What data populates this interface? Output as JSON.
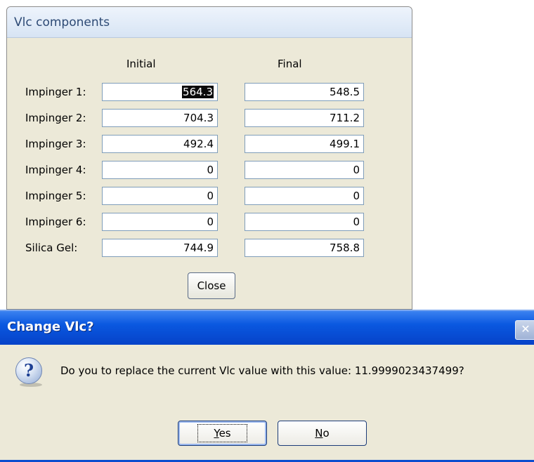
{
  "vlc_window": {
    "title": "Vlc components",
    "columns": {
      "initial": "Initial",
      "final": "Final"
    },
    "rows": [
      {
        "label": "Impinger 1:",
        "initial": "564.3",
        "final": "548.5"
      },
      {
        "label": "Impinger 2:",
        "initial": "704.3",
        "final": "711.2"
      },
      {
        "label": "Impinger 3:",
        "initial": "492.4",
        "final": "499.1"
      },
      {
        "label": "Impinger 4:",
        "initial": "0",
        "final": "0"
      },
      {
        "label": "Impinger 5:",
        "initial": "0",
        "final": "0"
      },
      {
        "label": "Impinger 6:",
        "initial": "0",
        "final": "0"
      },
      {
        "label": "Silica Gel:",
        "initial": "744.9",
        "final": "758.8"
      }
    ],
    "close_label": "Close"
  },
  "dialog": {
    "title": "Change Vlc?",
    "close_glyph": "✕",
    "icon": "question-icon",
    "icon_glyph": "?",
    "message": "Do you to replace the current Vlc value with this value:  11.9999023437499?",
    "yes_mnemonic": "Y",
    "yes_rest": "es",
    "no_mnemonic": "N",
    "no_rest": "o"
  },
  "colors": {
    "dialog_titlebar": "#0a58e0",
    "window_bg": "#ece9d8",
    "field_border": "#7f9db9"
  }
}
